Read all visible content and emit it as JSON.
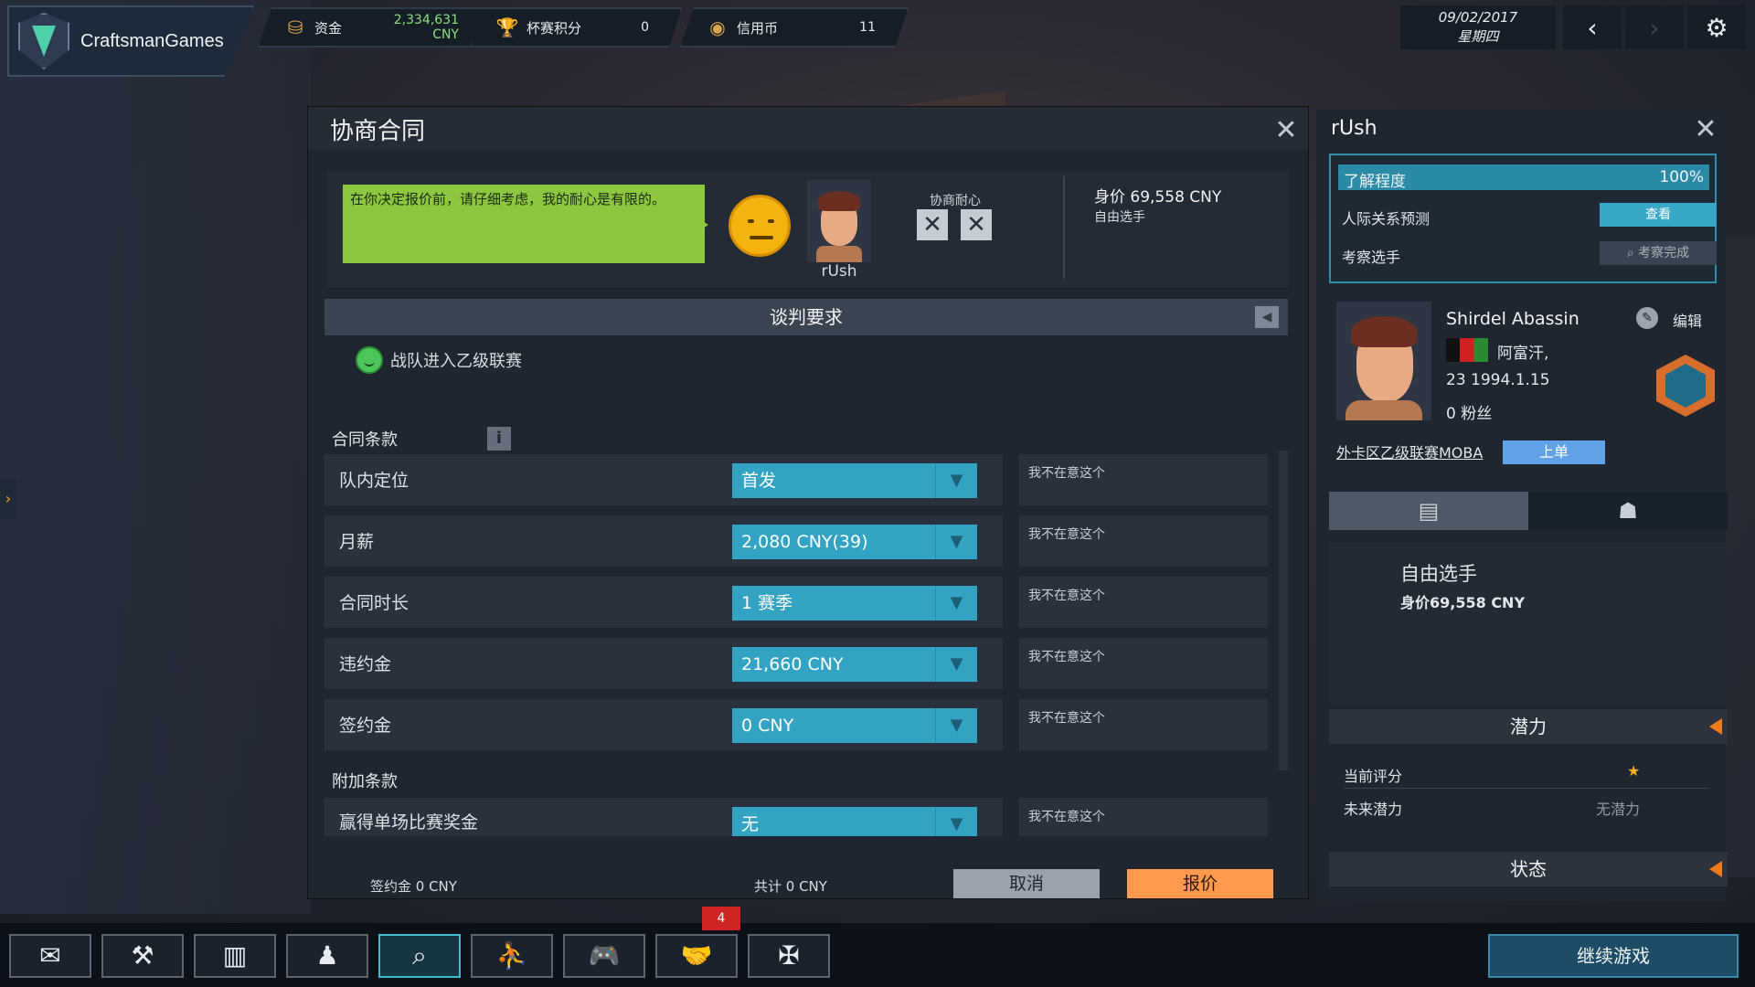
{
  "topbar": {
    "studio_name": "CraftsmanGames",
    "funds_label": "资金",
    "funds_value": "2,334,631",
    "funds_currency": "CNY",
    "cup_label": "杯赛积分",
    "cup_value": "0",
    "credit_label": "信用币",
    "credit_value": "11",
    "date": "09/02/2017",
    "weekday": "星期四"
  },
  "negotiation": {
    "title": "协商合同",
    "message": "在你决定报价前，请仔细考虑，我的耐心是有限的。",
    "player_name": "rUsh",
    "patience_label": "协商耐心",
    "player_value": "身价 69,558 CNY",
    "player_status": "自由选手",
    "requirements_title": "谈判要求",
    "requirement_1": "战队进入乙级联赛",
    "contract_terms_title": "合同条款",
    "terms": [
      {
        "label": "队内定位",
        "value": "首发",
        "note": "我不在意这个"
      },
      {
        "label": "月薪",
        "value": "2,080 CNY(39)",
        "note": "我不在意这个"
      },
      {
        "label": "合同时长",
        "value": "1 赛季",
        "note": "我不在意这个"
      },
      {
        "label": "违约金",
        "value": "21,660 CNY",
        "note": "我不在意这个"
      },
      {
        "label": "签约金",
        "value": "0 CNY",
        "note": "我不在意这个"
      }
    ],
    "extra_terms_title": "附加条款",
    "extra_terms": [
      {
        "label": "赢得单场比赛奖金",
        "value": "无",
        "note": "我不在意这个"
      }
    ],
    "footer_signing": "签约金  0 CNY",
    "footer_total": "共计  0 CNY",
    "cancel_label": "取消",
    "offer_label": "报价"
  },
  "player_panel": {
    "title": "rUsh",
    "knowledge_label": "了解程度",
    "knowledge_value": "100%",
    "relation_label": "人际关系预测",
    "relation_btn": "查看",
    "scout_label": "考察选手",
    "scout_btn": "考察完成",
    "full_name": "Shirdel Abassin",
    "edit_label": "编辑",
    "country": "阿富汗,",
    "age_birth": "23   1994.1.15",
    "fans": "0 粉丝",
    "league_link": "外卡区乙级联赛MOBA",
    "league_btn": "上单",
    "status_main": "自由选手",
    "status_value": "身价69,558 CNY",
    "potential_title": "潜力",
    "current_rating_label": "当前评分",
    "current_rating_star": "★",
    "future_label": "未来潜力",
    "future_value": "无潜力",
    "state_title": "状态"
  },
  "bottombar": {
    "badge_count": "4",
    "continue_label": "继续游戏"
  },
  "colors": {
    "accent": "#33a3c4",
    "offer": "#ff9a4d",
    "bubble": "#8dc63f"
  }
}
